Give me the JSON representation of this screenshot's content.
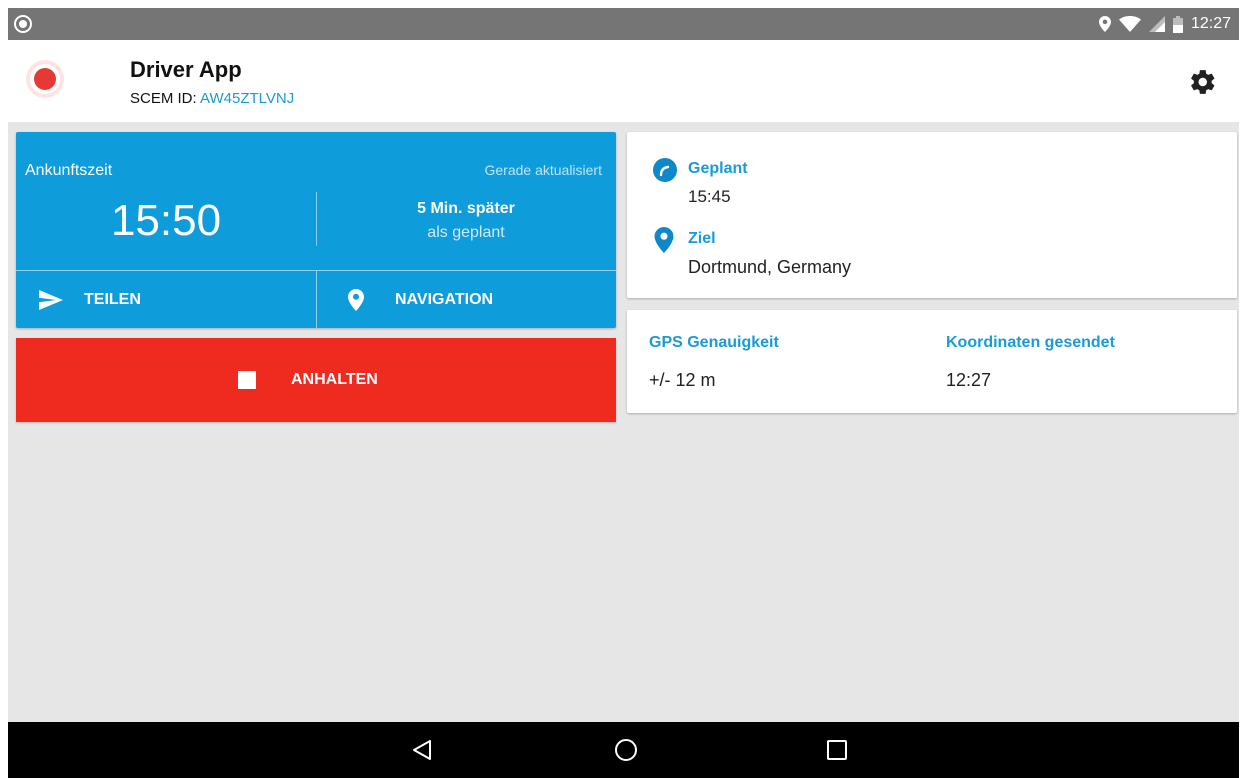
{
  "status_bar": {
    "time": "12:27",
    "icons": [
      "location-icon",
      "wifi-icon",
      "signal-icon",
      "battery-icon"
    ]
  },
  "app_bar": {
    "title": "Driver App",
    "id_label": "SCEM ID:",
    "id_value": "AW45ZTLVNJ",
    "icons": [
      "record-icon",
      "gear-icon"
    ]
  },
  "eta_card": {
    "label": "Ankunftszeit",
    "updated": "Gerade aktualisiert",
    "time": "15:50",
    "delay": "5 Min. später",
    "delay_sub": "als geplant",
    "share_label": "TEILEN",
    "navigation_label": "NAVIGATION"
  },
  "stop_button": {
    "label": "ANHALTEN"
  },
  "info_card": {
    "planned_label": "Geplant",
    "planned_value": "15:45",
    "destination_label": "Ziel",
    "destination_value": "Dortmund, Germany"
  },
  "gps_card": {
    "accuracy_label": "GPS Genauigkeit",
    "accuracy_value": "+/- 12 m",
    "sent_label": "Koordinaten gesendet",
    "sent_value": "12:27"
  },
  "colors": {
    "primary": "#0e9cdb",
    "accent_text": "#1a9ad6",
    "stop": "#ef2a1e",
    "background": "#e6e6e6",
    "status_bar": "#757575"
  }
}
